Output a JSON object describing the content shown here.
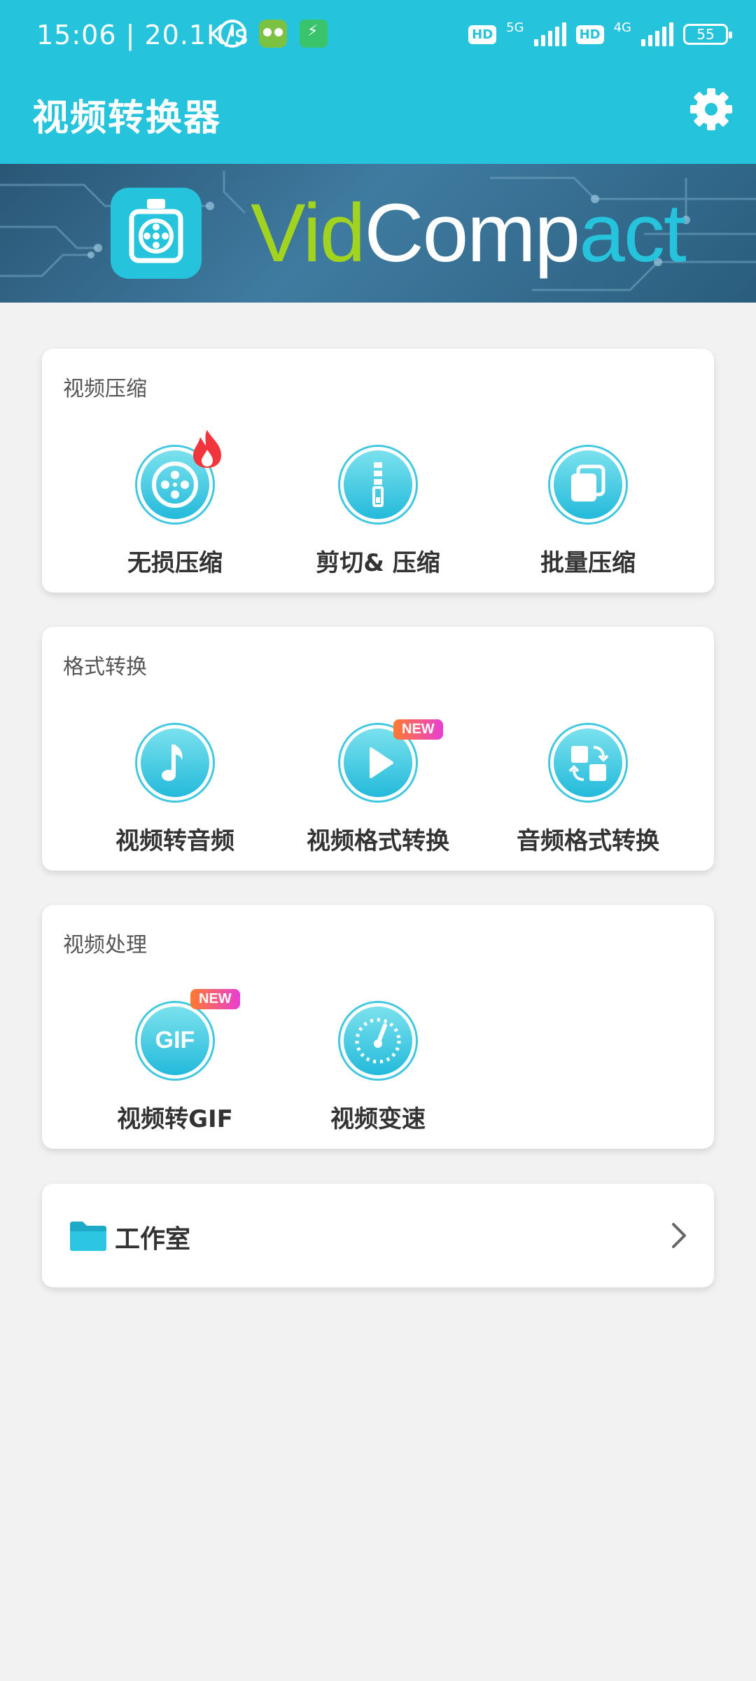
{
  "status_bar": {
    "time_speed": "15:06 | 20.1K/s",
    "hd1": "HD",
    "net1": "5G",
    "hd2": "HD",
    "net2": "4G",
    "battery": "55"
  },
  "header": {
    "title": "视频转换器",
    "settings_icon": "gear-icon"
  },
  "banner": {
    "word_vid": "Vid",
    "word_comp": "Comp",
    "word_act": "act"
  },
  "sections": [
    {
      "title": "视频压缩",
      "tools": [
        {
          "label": "无损压缩",
          "icon": "film-reel-icon",
          "badge": "hot"
        },
        {
          "label": "剪切& 压缩",
          "icon": "zip-icon"
        },
        {
          "label": "批量压缩",
          "icon": "stack-icon"
        }
      ]
    },
    {
      "title": "格式转换",
      "tools": [
        {
          "label": "视频转音频",
          "icon": "music-note-icon"
        },
        {
          "label": "视频格式转换",
          "icon": "play-icon",
          "badge": "NEW"
        },
        {
          "label": "音频格式转换",
          "icon": "convert-icon"
        }
      ]
    },
    {
      "title": "视频处理",
      "tools": [
        {
          "label": "视频转GIF",
          "icon": "gif-icon",
          "badge": "NEW",
          "icon_text": "GIF"
        },
        {
          "label": "视频变速",
          "icon": "speedometer-icon"
        }
      ]
    }
  ],
  "studio": {
    "label": "工作室"
  },
  "colors": {
    "primary": "#26c3dc",
    "background": "#f2f2f2"
  }
}
